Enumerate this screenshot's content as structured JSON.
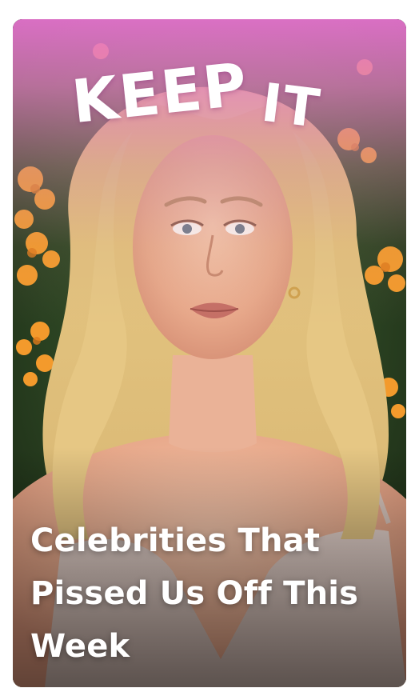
{
  "card": {
    "tag": [
      "KEEP",
      "IT"
    ],
    "title": "Celebrities That Pissed Us Off This Week"
  },
  "colors": {
    "pink_overlay": "#e874d2",
    "hedge_green": "#2f4a25",
    "flower_orange": "#f29a2e",
    "text": "#ffffff"
  }
}
